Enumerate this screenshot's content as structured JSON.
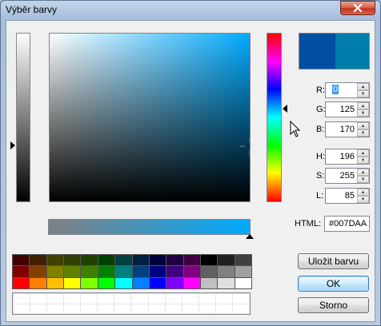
{
  "window": {
    "title": "Výběr barvy"
  },
  "preview": {
    "old_color": "#004FA3",
    "new_color": "#007DAA"
  },
  "fields": {
    "r": {
      "label": "R:",
      "value": "0"
    },
    "g": {
      "label": "G:",
      "value": "125"
    },
    "b": {
      "label": "B:",
      "value": "170"
    },
    "h": {
      "label": "H:",
      "value": "196"
    },
    "s": {
      "label": "S:",
      "value": "255"
    },
    "l": {
      "label": "L:",
      "value": "85"
    }
  },
  "html": {
    "label": "HTML:",
    "value": "#007DAA"
  },
  "buttons": {
    "save": "Uložit barvu",
    "ok": "OK",
    "cancel": "Storno"
  },
  "palette": [
    "#400000",
    "#402000",
    "#404000",
    "#304000",
    "#204000",
    "#004000",
    "#004040",
    "#002040",
    "#000040",
    "#200040",
    "#400040",
    "#000000",
    "#202020",
    "#404040",
    "#800000",
    "#804000",
    "#808000",
    "#608000",
    "#408000",
    "#008000",
    "#008080",
    "#004080",
    "#000080",
    "#400080",
    "#800080",
    "#606060",
    "#808080",
    "#a0a0a0",
    "#ff0000",
    "#ff8000",
    "#ffc000",
    "#ffff00",
    "#80ff00",
    "#00ff00",
    "#00ffff",
    "#0080ff",
    "#0000ff",
    "#8000ff",
    "#ff00ff",
    "#c0c0c0",
    "#e0e0e0",
    "#ffffff"
  ]
}
